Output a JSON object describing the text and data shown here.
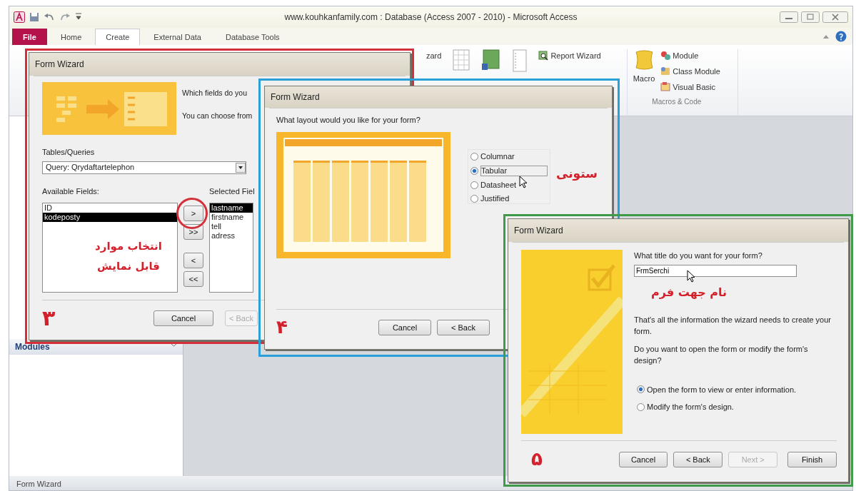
{
  "window": {
    "title": "www.kouhkanfamily.com : Database (Access 2007 - 2010) - Microsoft Access"
  },
  "ribbon": {
    "tabs": [
      {
        "label": "File",
        "kind": "file",
        "selected": false
      },
      {
        "label": "Home",
        "kind": "tab",
        "selected": false
      },
      {
        "label": "Create",
        "kind": "tab",
        "selected": true
      },
      {
        "label": "External Data",
        "kind": "tab",
        "selected": false
      },
      {
        "label": "Database Tools",
        "kind": "tab",
        "selected": false
      }
    ],
    "commands": [
      "zard",
      "Report Wizard"
    ],
    "macro": "Macro",
    "code_items": [
      "Module",
      "Class Module",
      "Visual Basic"
    ],
    "group_label": "Macros & Code"
  },
  "nav_pane": {
    "header": "Modules"
  },
  "status_bar": {
    "text": "Form Wizard"
  },
  "field_wizard": {
    "title": "Form Wizard",
    "intro": [
      "Which fields do you",
      "You can choose from"
    ],
    "tables_label": "Tables/Queries",
    "query": "Query: Qrydaftartelephon",
    "available_label": "Available Fields:",
    "available": [
      {
        "label": "ID",
        "selected": false
      },
      {
        "label": "kodeposty",
        "selected": true
      }
    ],
    "move_buttons": [
      ">",
      ">>",
      "<",
      "<<"
    ],
    "selected_label": "Selected Fiel",
    "selected_fields": [
      {
        "label": "lastname",
        "selected": true
      },
      {
        "label": "firstname",
        "selected": false
      },
      {
        "label": "tell",
        "selected": false
      },
      {
        "label": "adress",
        "selected": false
      }
    ],
    "buttons": [
      {
        "label": "Cancel",
        "disabled": false
      },
      {
        "label": "< Back",
        "disabled": true
      }
    ],
    "note": "انتخاب موارد قابل نمایش",
    "step": "۳"
  },
  "layout_wizard": {
    "title": "Form Wizard",
    "question": "What layout would you like for your form?",
    "layouts": [
      {
        "label": "Columnar",
        "selected": false
      },
      {
        "label": "Tabular",
        "selected": true
      },
      {
        "label": "Datasheet",
        "selected": false
      },
      {
        "label": "Justified",
        "selected": false
      }
    ],
    "note": "ستونی",
    "buttons": [
      {
        "label": "Cancel",
        "disabled": false
      },
      {
        "label": "< Back",
        "disabled": false
      }
    ],
    "step": "۴"
  },
  "title_wizard": {
    "title": "Form Wizard",
    "question": "What title do you want for your form?",
    "form_title": "FrmSerchi",
    "note": "نام جهت فرم",
    "info": "That's all the information the wizard needs to create your form.",
    "open_question": "Do you want to open the form or modify the form's design?",
    "options": [
      {
        "label": "Open the form to view or enter information.",
        "selected": true
      },
      {
        "label": "Modify the form's design.",
        "selected": false
      }
    ],
    "buttons": [
      {
        "label": "Cancel",
        "disabled": false
      },
      {
        "label": "< Back",
        "disabled": false
      },
      {
        "label": "Next >",
        "disabled": true
      },
      {
        "label": "Finish",
        "disabled": false
      }
    ],
    "step": "۵"
  }
}
